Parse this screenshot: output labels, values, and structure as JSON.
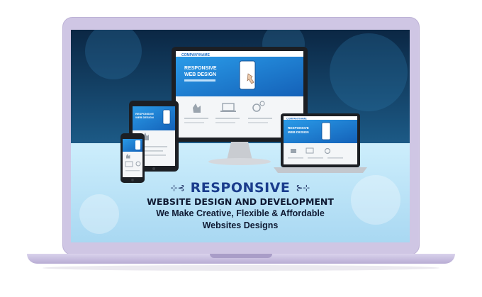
{
  "banner": {
    "ornament_left": "⊹⊰",
    "ornament_right": "⊱⊹",
    "title": "RESPONSIVE",
    "subtitle": "WEBSITE DESIGN AND DEVELOPMENT",
    "tagline_line1": "We Make Creative, Flexible & Affordable",
    "tagline_line2": "Websites Designs"
  },
  "devices": {
    "monitor_brand": "COMPANYNAME",
    "monitor_heading_1": "RESPONSIVE",
    "monitor_heading_2": "WEB DESIGN",
    "laptop_brand": "COMPANYNAME",
    "laptop_heading_1": "RESPONSIVE",
    "laptop_heading_2": "WEB DESIGN",
    "tablet_heading_1": "RESPONSIVE",
    "tablet_heading_2": "WEB DESIGN"
  },
  "colors": {
    "frame": "#cfc6e4",
    "background_dark": "#0d2a4a",
    "background_light": "#bfe3f6",
    "title_blue": "#1a3c8c",
    "device_blue": "#1e88d8"
  }
}
